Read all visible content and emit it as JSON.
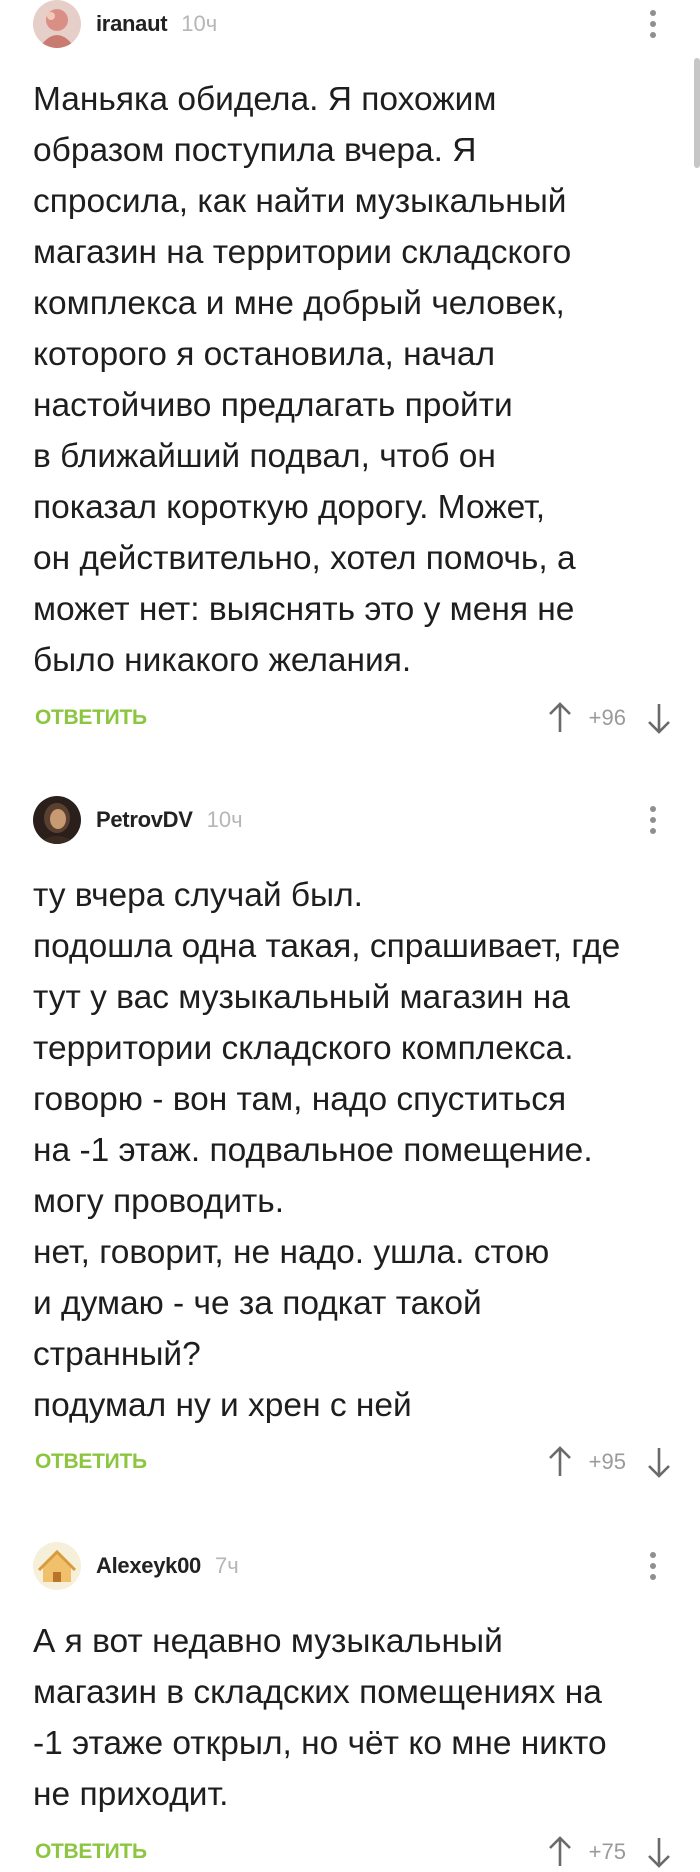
{
  "comments": [
    {
      "username": "iranaut",
      "time": "10ч",
      "text": "Маньяка обидела. Я похожим\nобразом поступила вчера. Я\nспросила, как найти музыкальный\nмагазин на территории складского\nкомплекса и мне добрый человек,\nкоторого я остановила, начал\nнастойчиво предлагать пройти\nв ближайший подвал, чтоб он\nпоказал короткую дорогу. Может,\nон действительно, хотел помочь, а\nможет нет: выяснять это у меня не\nбыло никакого желания.",
      "reply_label": "ОТВЕТИТЬ",
      "rating": "+96",
      "avatar_icon": "user-avatar-pink-icon"
    },
    {
      "username": "PetrovDV",
      "time": "10ч",
      "text": "ту вчера случай был.\nподошла одна такая, спрашивает, где\nтут у вас музыкальный магазин на\nтерритории складского комплекса.\nговорю - вон там, надо спуститься\nна -1 этаж. подвальное помещение.\nмогу проводить.\nнет, говорит, не надо. ушла. стою\nи думаю - че за подкат такой\nстранный?\nподумал ну и хрен с ней",
      "reply_label": "ОТВЕТИТЬ",
      "rating": "+95",
      "avatar_icon": "user-avatar-portrait-icon"
    },
    {
      "username": "Alexeyk00",
      "time": "7ч",
      "text": "А я вот недавно музыкальный\nмагазин в складских помещениях на\n-1 этаже открыл, но чёт ко мне никто\nне приходит.",
      "reply_label": "ОТВЕТИТЬ",
      "rating": "+75",
      "avatar_icon": "user-avatar-house-icon"
    }
  ],
  "icons": {
    "more": "more-vertical-icon",
    "upvote": "arrow-up-icon",
    "downvote": "arrow-down-icon"
  },
  "colors": {
    "reply": "#8cc640",
    "rating": "#9a9a9a",
    "time": "#b6b6b6"
  }
}
